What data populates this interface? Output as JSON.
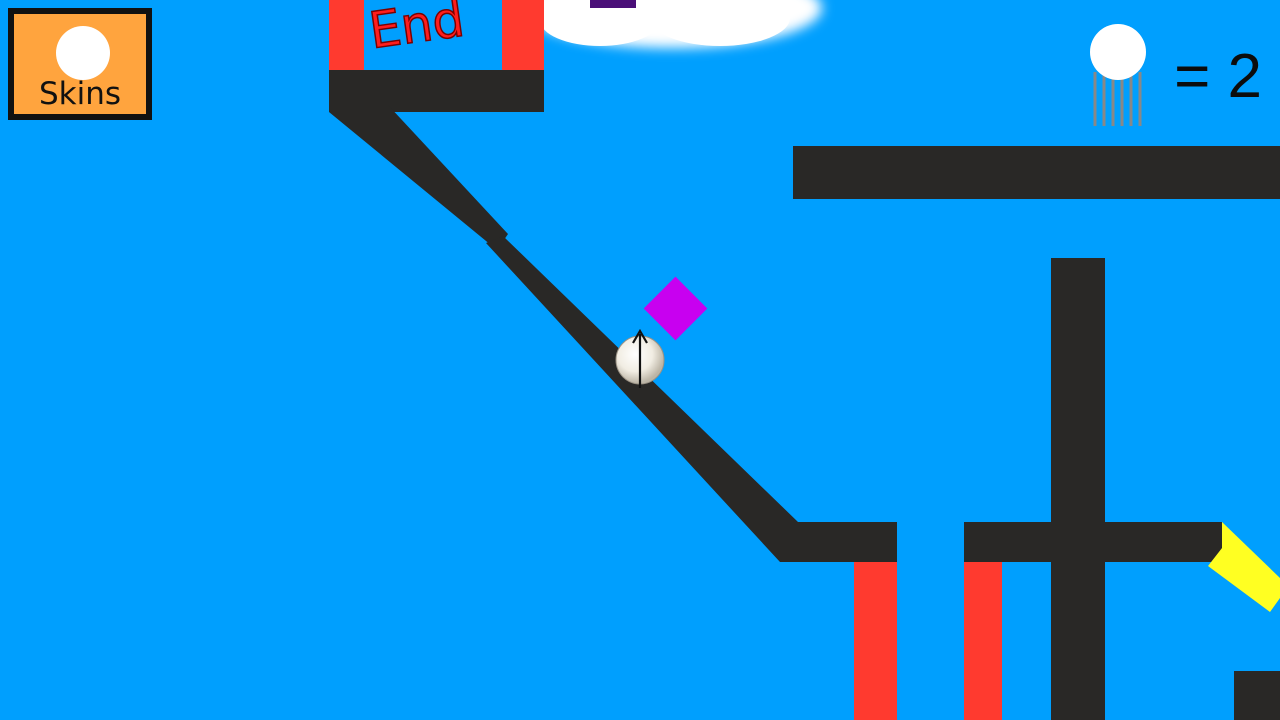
{
  "hud": {
    "skins_label": "Skins",
    "lives_counter": "= 2"
  },
  "level": {
    "end_label": "End"
  },
  "colors": {
    "sky": "#009ffe",
    "wall": "#292826",
    "hazard": "#ff3a2f",
    "goal_arrow": "#c800f0",
    "jump_pad": "#ffff22",
    "skins_bg": "#ffa43e",
    "purple_block": "#4a0f78"
  },
  "icons": [
    "ball-icon",
    "lives-ball-icon"
  ]
}
